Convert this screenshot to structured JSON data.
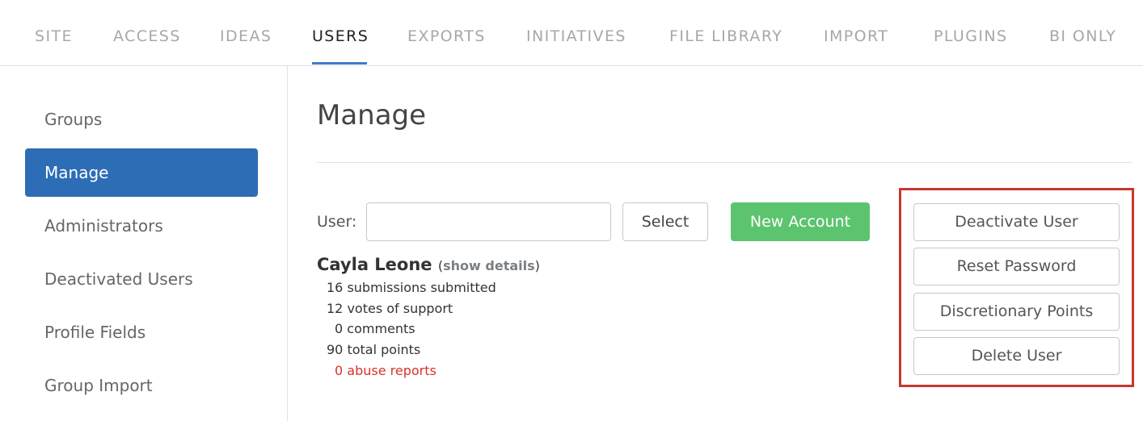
{
  "nav": {
    "tabs": [
      {
        "label": "SITE"
      },
      {
        "label": "ACCESS"
      },
      {
        "label": "IDEAS"
      },
      {
        "label": "USERS"
      },
      {
        "label": "EXPORTS"
      },
      {
        "label": "INITIATIVES"
      },
      {
        "label": "FILE LIBRARY"
      },
      {
        "label": "IMPORT"
      },
      {
        "label": "PLUGINS"
      },
      {
        "label": "BI ONLY"
      }
    ],
    "active_tab": "USERS"
  },
  "sidebar": {
    "items": [
      {
        "label": "Groups"
      },
      {
        "label": "Manage"
      },
      {
        "label": "Administrators"
      },
      {
        "label": "Deactivated Users"
      },
      {
        "label": "Profile Fields"
      },
      {
        "label": "Group Import"
      }
    ],
    "active_item": "Manage"
  },
  "main": {
    "title": "Manage",
    "user_label": "User:",
    "user_input_value": "",
    "select_label": "Select",
    "new_account_label": "New Account",
    "user_name": "Cayla Leone",
    "show_details_open": "(",
    "show_details_link": "show details",
    "show_details_close": ")",
    "stats": {
      "submissions": "16 submissions submitted",
      "votes": "12 votes of support",
      "comments": "0 comments",
      "points": "90 total points",
      "abuse": "0 abuse reports"
    },
    "actions": {
      "deactivate": "Deactivate User",
      "reset_password": "Reset Password",
      "discretionary_points": "Discretionary Points",
      "delete": "Delete User"
    }
  },
  "colors": {
    "accent": "#2d6db5",
    "new_account": "#5cc46e",
    "highlight": "#c9372c",
    "abuse": "#d9332b"
  }
}
